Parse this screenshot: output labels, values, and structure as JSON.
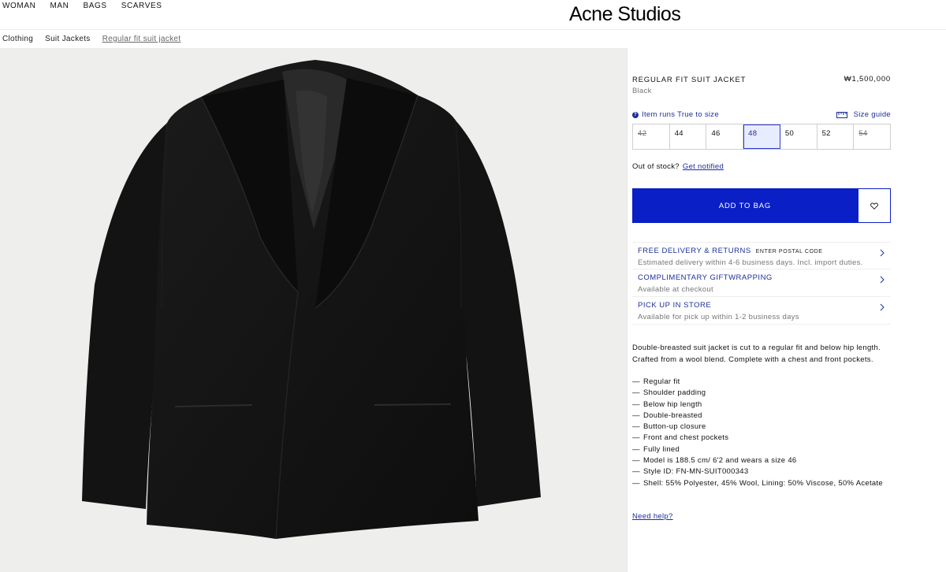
{
  "nav": {
    "items": [
      "WOMAN",
      "MAN",
      "BAGS",
      "SCARVES"
    ],
    "logo": "Acne Studios"
  },
  "breadcrumb": [
    "Clothing",
    "Suit Jackets",
    "Regular fit suit jacket"
  ],
  "product": {
    "title": "REGULAR FIT SUIT JACKET",
    "price": "₩1,500,000",
    "color": "Black",
    "fit_note": "Item runs True to size",
    "size_guide": "Size guide",
    "sizes": [
      {
        "label": "42",
        "available": false
      },
      {
        "label": "44",
        "available": true
      },
      {
        "label": "46",
        "available": true
      },
      {
        "label": "48",
        "available": true,
        "selected": true
      },
      {
        "label": "50",
        "available": true
      },
      {
        "label": "52",
        "available": true
      },
      {
        "label": "54",
        "available": false
      }
    ],
    "out_of_stock_text": "Out of stock?",
    "get_notified": "Get notified",
    "add_to_bag": "ADD TO BAG"
  },
  "services": [
    {
      "title": "FREE DELIVERY & RETURNS",
      "extra": "ENTER POSTAL CODE",
      "sub": "Estimated delivery within 4-6 business days. Incl. import duties."
    },
    {
      "title": "COMPLIMENTARY GIFTWRAPPING",
      "extra": "",
      "sub": "Available at checkout"
    },
    {
      "title": "PICK UP IN STORE",
      "extra": "",
      "sub": "Available for pick up within 1-2 business days"
    }
  ],
  "description": "Double-breasted suit jacket is cut to a regular fit and below hip length. Crafted from a wool blend. Complete with a chest and front pockets.",
  "details": [
    "Regular fit",
    "Shoulder padding",
    "Below hip length",
    "Double-breasted",
    "Button-up closure",
    "Front and chest pockets",
    "Fully lined",
    "Model is 188.5 cm/ 6'2 and wears a size 46",
    "Style ID: FN-MN-SUIT000343",
    "Shell: 55% Polyester, 45% Wool, Lining: 50% Viscose, 50% Acetate"
  ],
  "help": "Need help?",
  "colors": {
    "accent": "#0b1fc7",
    "link": "#1d2e9a",
    "image_bg": "#eeeeed"
  }
}
